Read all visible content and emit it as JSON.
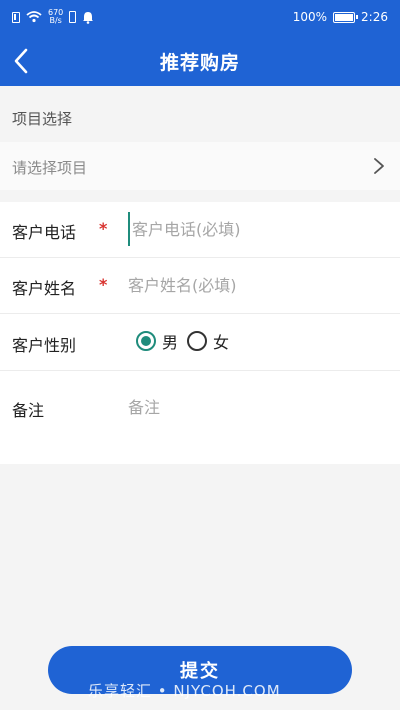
{
  "status_bar": {
    "net_speed_value": "670",
    "net_speed_unit": "B/s",
    "battery": "100%",
    "time": "2:26",
    "icons": [
      "sim-icon",
      "wifi-icon",
      "vibrate-icon",
      "notification-bell-icon",
      "battery-icon"
    ]
  },
  "header": {
    "title": "推荐购房",
    "back_icon": "back-chevron-icon"
  },
  "project": {
    "section_label": "项目选择",
    "placeholder": "请选择项目",
    "chevron_icon": "chevron-right-icon"
  },
  "form": {
    "phone": {
      "label": "客户电话",
      "required_mark": "*",
      "placeholder": "客户电话(必填)"
    },
    "name": {
      "label": "客户姓名",
      "required_mark": "*",
      "placeholder": "客户姓名(必填)"
    },
    "gender": {
      "label": "客户性别",
      "options": [
        {
          "label": "男",
          "checked": true
        },
        {
          "label": "女",
          "checked": false
        }
      ]
    },
    "note": {
      "label": "备注",
      "placeholder": "备注"
    }
  },
  "submit_label": "提交",
  "watermark": "乐享轻汇 • NJYCOH.COM",
  "colors": {
    "primary": "#1f63d4",
    "radio_checked": "#1f8c7c",
    "required": "#d8332f"
  }
}
